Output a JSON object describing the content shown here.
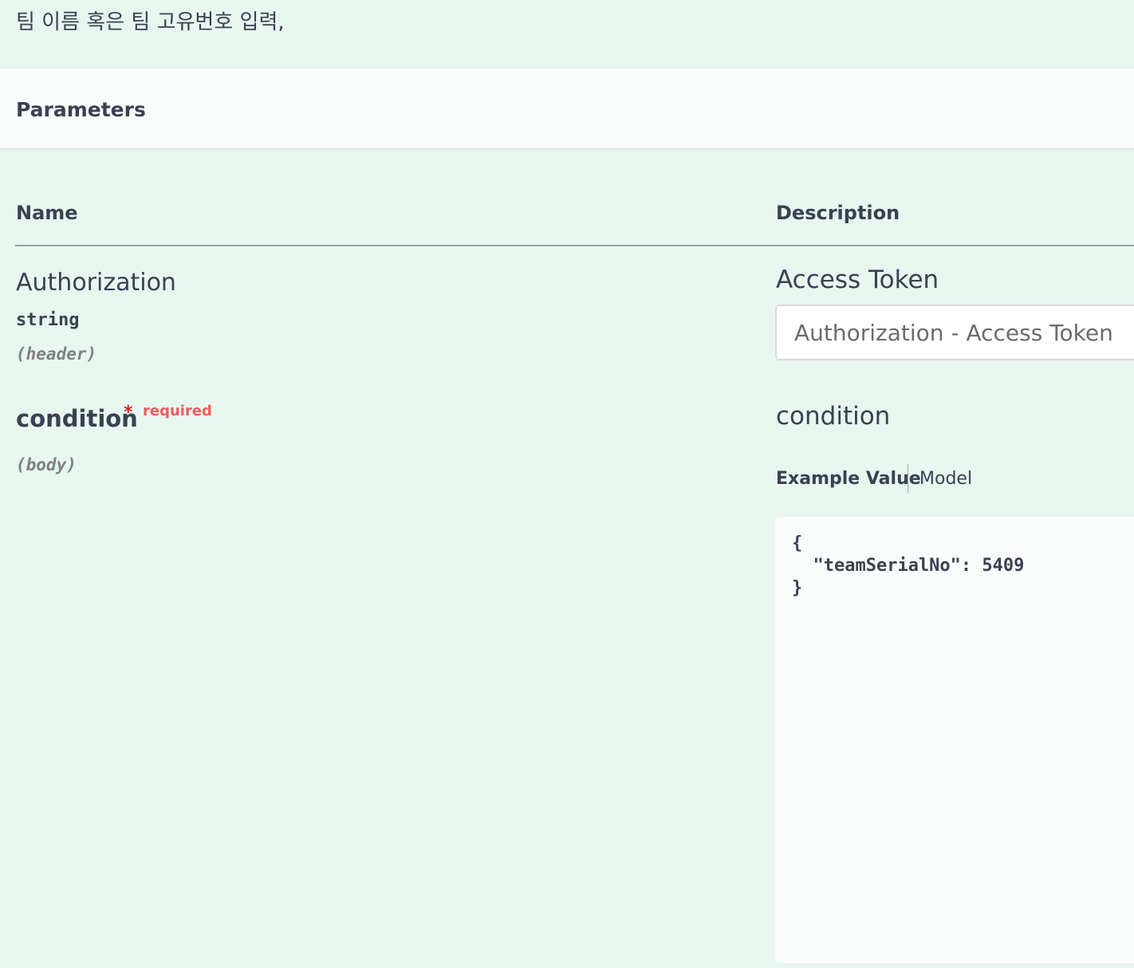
{
  "summary": {
    "text": "팀 이름 혹은 팀 고유번호 입력,"
  },
  "parameters": {
    "title": "Parameters",
    "columns": {
      "name": "Name",
      "description": "Description"
    },
    "items": [
      {
        "name": "Authorization",
        "type": "string",
        "in": "(header)",
        "description": "Access Token",
        "input_placeholder": "Authorization - Access Token",
        "input_value": ""
      },
      {
        "name": "condition",
        "required_star": "*",
        "required_label": "required",
        "in": "(body)",
        "description": "condition",
        "tabs": {
          "example": "Example Value",
          "model": "Model"
        },
        "example_value": "{\n  \"teamSerialNo\": 5409\n}"
      }
    ]
  }
}
